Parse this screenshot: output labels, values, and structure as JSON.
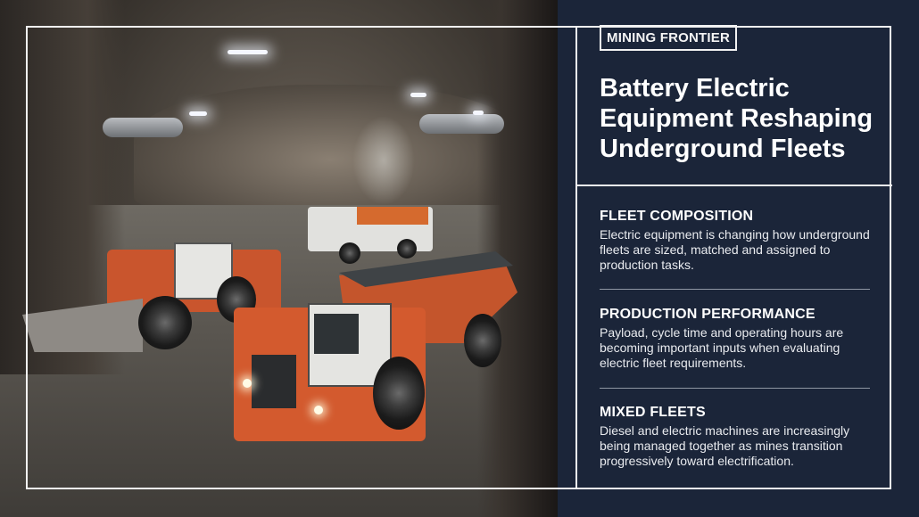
{
  "brand": {
    "name": "MINING FRONTIER"
  },
  "headline": "Battery Electric Equipment Reshaping Underground Fleets",
  "sections": [
    {
      "title": "FLEET COMPOSITION",
      "body": "Electric equipment is changing how underground fleets are sized, matched and assigned to production tasks."
    },
    {
      "title": "PRODUCTION PERFORMANCE",
      "body": "Payload, cycle time and operating hours are becoming important inputs when evaluating electric fleet requirements."
    },
    {
      "title": "MIXED FLEETS",
      "body": "Diesel and electric machines are increasingly being managed together as mines transition progressively toward electrification."
    }
  ],
  "colors": {
    "panel_background": "#1b2539",
    "frame": "#f2f2f2",
    "equipment_orange": "#c9552d"
  }
}
